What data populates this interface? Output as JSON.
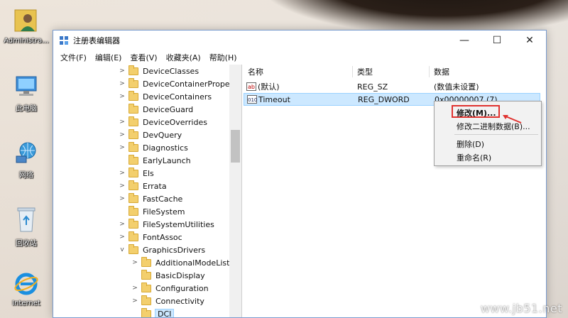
{
  "desktop": {
    "icons": [
      {
        "label": "Administra...",
        "icon": "user-folder-icon"
      },
      {
        "label": "此电脑",
        "icon": "computer-icon"
      },
      {
        "label": "网络",
        "icon": "network-icon"
      },
      {
        "label": "回收站",
        "icon": "recycle-bin-icon"
      },
      {
        "label": "Internet",
        "icon": "internet-explorer-icon"
      }
    ]
  },
  "window": {
    "title": "注册表编辑器",
    "buttons": {
      "minimize": "—",
      "maximize": "☐",
      "close": "✕"
    },
    "menu": [
      "文件(F)",
      "编辑(E)",
      "查看(V)",
      "收藏夹(A)",
      "帮助(H)"
    ]
  },
  "tree": {
    "items": [
      {
        "label": "DeviceClasses",
        "expander": ">",
        "level": 0
      },
      {
        "label": "DeviceContainerPropert",
        "expander": ">",
        "level": 0
      },
      {
        "label": "DeviceContainers",
        "expander": ">",
        "level": 0
      },
      {
        "label": "DeviceGuard",
        "expander": "",
        "level": 0
      },
      {
        "label": "DeviceOverrides",
        "expander": ">",
        "level": 0
      },
      {
        "label": "DevQuery",
        "expander": ">",
        "level": 0
      },
      {
        "label": "Diagnostics",
        "expander": ">",
        "level": 0
      },
      {
        "label": "EarlyLaunch",
        "expander": "",
        "level": 0
      },
      {
        "label": "Els",
        "expander": ">",
        "level": 0
      },
      {
        "label": "Errata",
        "expander": ">",
        "level": 0
      },
      {
        "label": "FastCache",
        "expander": ">",
        "level": 0
      },
      {
        "label": "FileSystem",
        "expander": "",
        "level": 0
      },
      {
        "label": "FileSystemUtilities",
        "expander": ">",
        "level": 0
      },
      {
        "label": "FontAssoc",
        "expander": ">",
        "level": 0
      },
      {
        "label": "GraphicsDrivers",
        "expander": "v",
        "level": 0
      },
      {
        "label": "AdditionalModeLists",
        "expander": ">",
        "level": 1
      },
      {
        "label": "BasicDisplay",
        "expander": "",
        "level": 1
      },
      {
        "label": "Configuration",
        "expander": ">",
        "level": 1
      },
      {
        "label": "Connectivity",
        "expander": ">",
        "level": 1
      },
      {
        "label": "DCI",
        "expander": "",
        "level": 1,
        "selected": true
      }
    ]
  },
  "values": {
    "headers": {
      "name": "名称",
      "type": "类型",
      "data": "数据"
    },
    "rows": [
      {
        "icon": "string-value-icon",
        "icon_text": "ab",
        "name": "(默认)",
        "type": "REG_SZ",
        "data": "(数值未设置)"
      },
      {
        "icon": "dword-value-icon",
        "icon_text": "010",
        "name": "Timeout",
        "type": "REG_DWORD",
        "data": "0x00000007 (7)",
        "selected": true
      }
    ]
  },
  "context_menu": {
    "modify": "修改(M)...",
    "modify_binary": "修改二进制数据(B)...",
    "delete": "删除(D)",
    "rename": "重命名(R)"
  },
  "colors": {
    "selection": "#cce8ff",
    "folder": "#f3cf6d",
    "highlight": "#e0322f"
  },
  "watermark": "www.jb51.net"
}
